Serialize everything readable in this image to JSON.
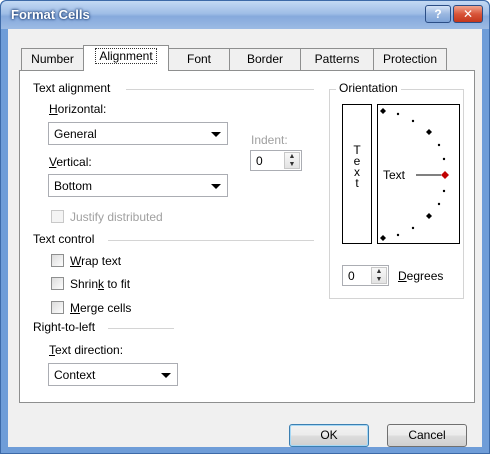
{
  "window": {
    "title": "Format Cells",
    "help_label": "?",
    "close_label": "✕"
  },
  "tabs": [
    {
      "label": "Number"
    },
    {
      "label": "Alignment"
    },
    {
      "label": "Font"
    },
    {
      "label": "Border"
    },
    {
      "label": "Patterns"
    },
    {
      "label": "Protection"
    }
  ],
  "alignment": {
    "section_label": "Text alignment",
    "horizontal_label_pre": "",
    "horizontal_label_u": "H",
    "horizontal_label_post": "orizontal:",
    "horizontal_value": "General",
    "vertical_label_u": "V",
    "vertical_label_post": "ertical:",
    "vertical_value": "Bottom",
    "indent_label": "Indent:",
    "indent_value": "0",
    "justify_label": "Justify distributed"
  },
  "text_control": {
    "section_label": "Text control",
    "wrap_u": "W",
    "wrap_post": "rap text",
    "shrink_pre": "Shrin",
    "shrink_u": "k",
    "shrink_post": " to fit",
    "merge_u": "M",
    "merge_post": "erge cells"
  },
  "rtl": {
    "section_label": "Right-to-left",
    "direction_label_u": "T",
    "direction_label_post": "ext direction:",
    "direction_value": "Context"
  },
  "orientation": {
    "section_label": "Orientation",
    "vertical_letters": [
      "T",
      "e",
      "x",
      "t"
    ],
    "dial_text": "Text",
    "degrees_value": "0",
    "degrees_label_u": "D",
    "degrees_label_post": "egrees",
    "marker_color": "#c00000"
  },
  "buttons": {
    "ok": "OK",
    "cancel": "Cancel"
  }
}
